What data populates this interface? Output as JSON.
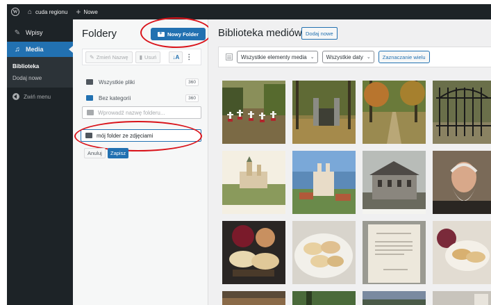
{
  "admin_bar": {
    "site_name": "cuda regionu",
    "new_label": "Nowe",
    "icons": [
      "wordpress-logo",
      "home-icon",
      "plus-icon"
    ]
  },
  "sidebar": {
    "items": [
      {
        "label": "Wpisy",
        "icon": "pin-icon"
      },
      {
        "label": "Media",
        "icon": "media-icon",
        "current": true
      }
    ],
    "submenu": [
      {
        "label": "Biblioteka",
        "active": true
      },
      {
        "label": "Dodaj nowe",
        "active": false
      }
    ],
    "collapse_label": "Zwiń menu",
    "colors": {
      "bg": "#1d2327",
      "accent": "#2271b1"
    }
  },
  "folders": {
    "title": "Foldery",
    "new_folder_button": "Nowy Folder",
    "rename_button": "Zmień Nazwę",
    "delete_button": "Usuń",
    "sort_icon": "sort-az-icon",
    "rows": [
      {
        "label": "Wszystkie pliki",
        "count": "360"
      },
      {
        "label": "Bez kategorii",
        "count": "360"
      }
    ],
    "search_placeholder": "Wprowadź nazwę folderu...",
    "new_folder_input_value": "mój folder ze zdjęciami",
    "cancel_button": "Anuluj",
    "save_button": "Zapisz"
  },
  "media": {
    "title": "Biblioteka mediów",
    "add_new_button": "Dodaj nowe",
    "filter_type": "Wszystkie elementy media",
    "filter_date": "Wszystkie daty",
    "bulk_select_button": "Zaznaczanie wielu",
    "thumbnails": [
      "cemetery-crosses",
      "park-gate-autumn",
      "autumn-alley",
      "wrought-iron-gate",
      "monastery-painting",
      "church-aerial",
      "old-manor",
      "old-man-portrait",
      "pierogi-onion",
      "pierogi-plate",
      "framed-document",
      "pierogi-dish",
      "partial-photo-1",
      "partial-photo-2",
      "partial-photo-3",
      "partial-photo-4"
    ]
  }
}
